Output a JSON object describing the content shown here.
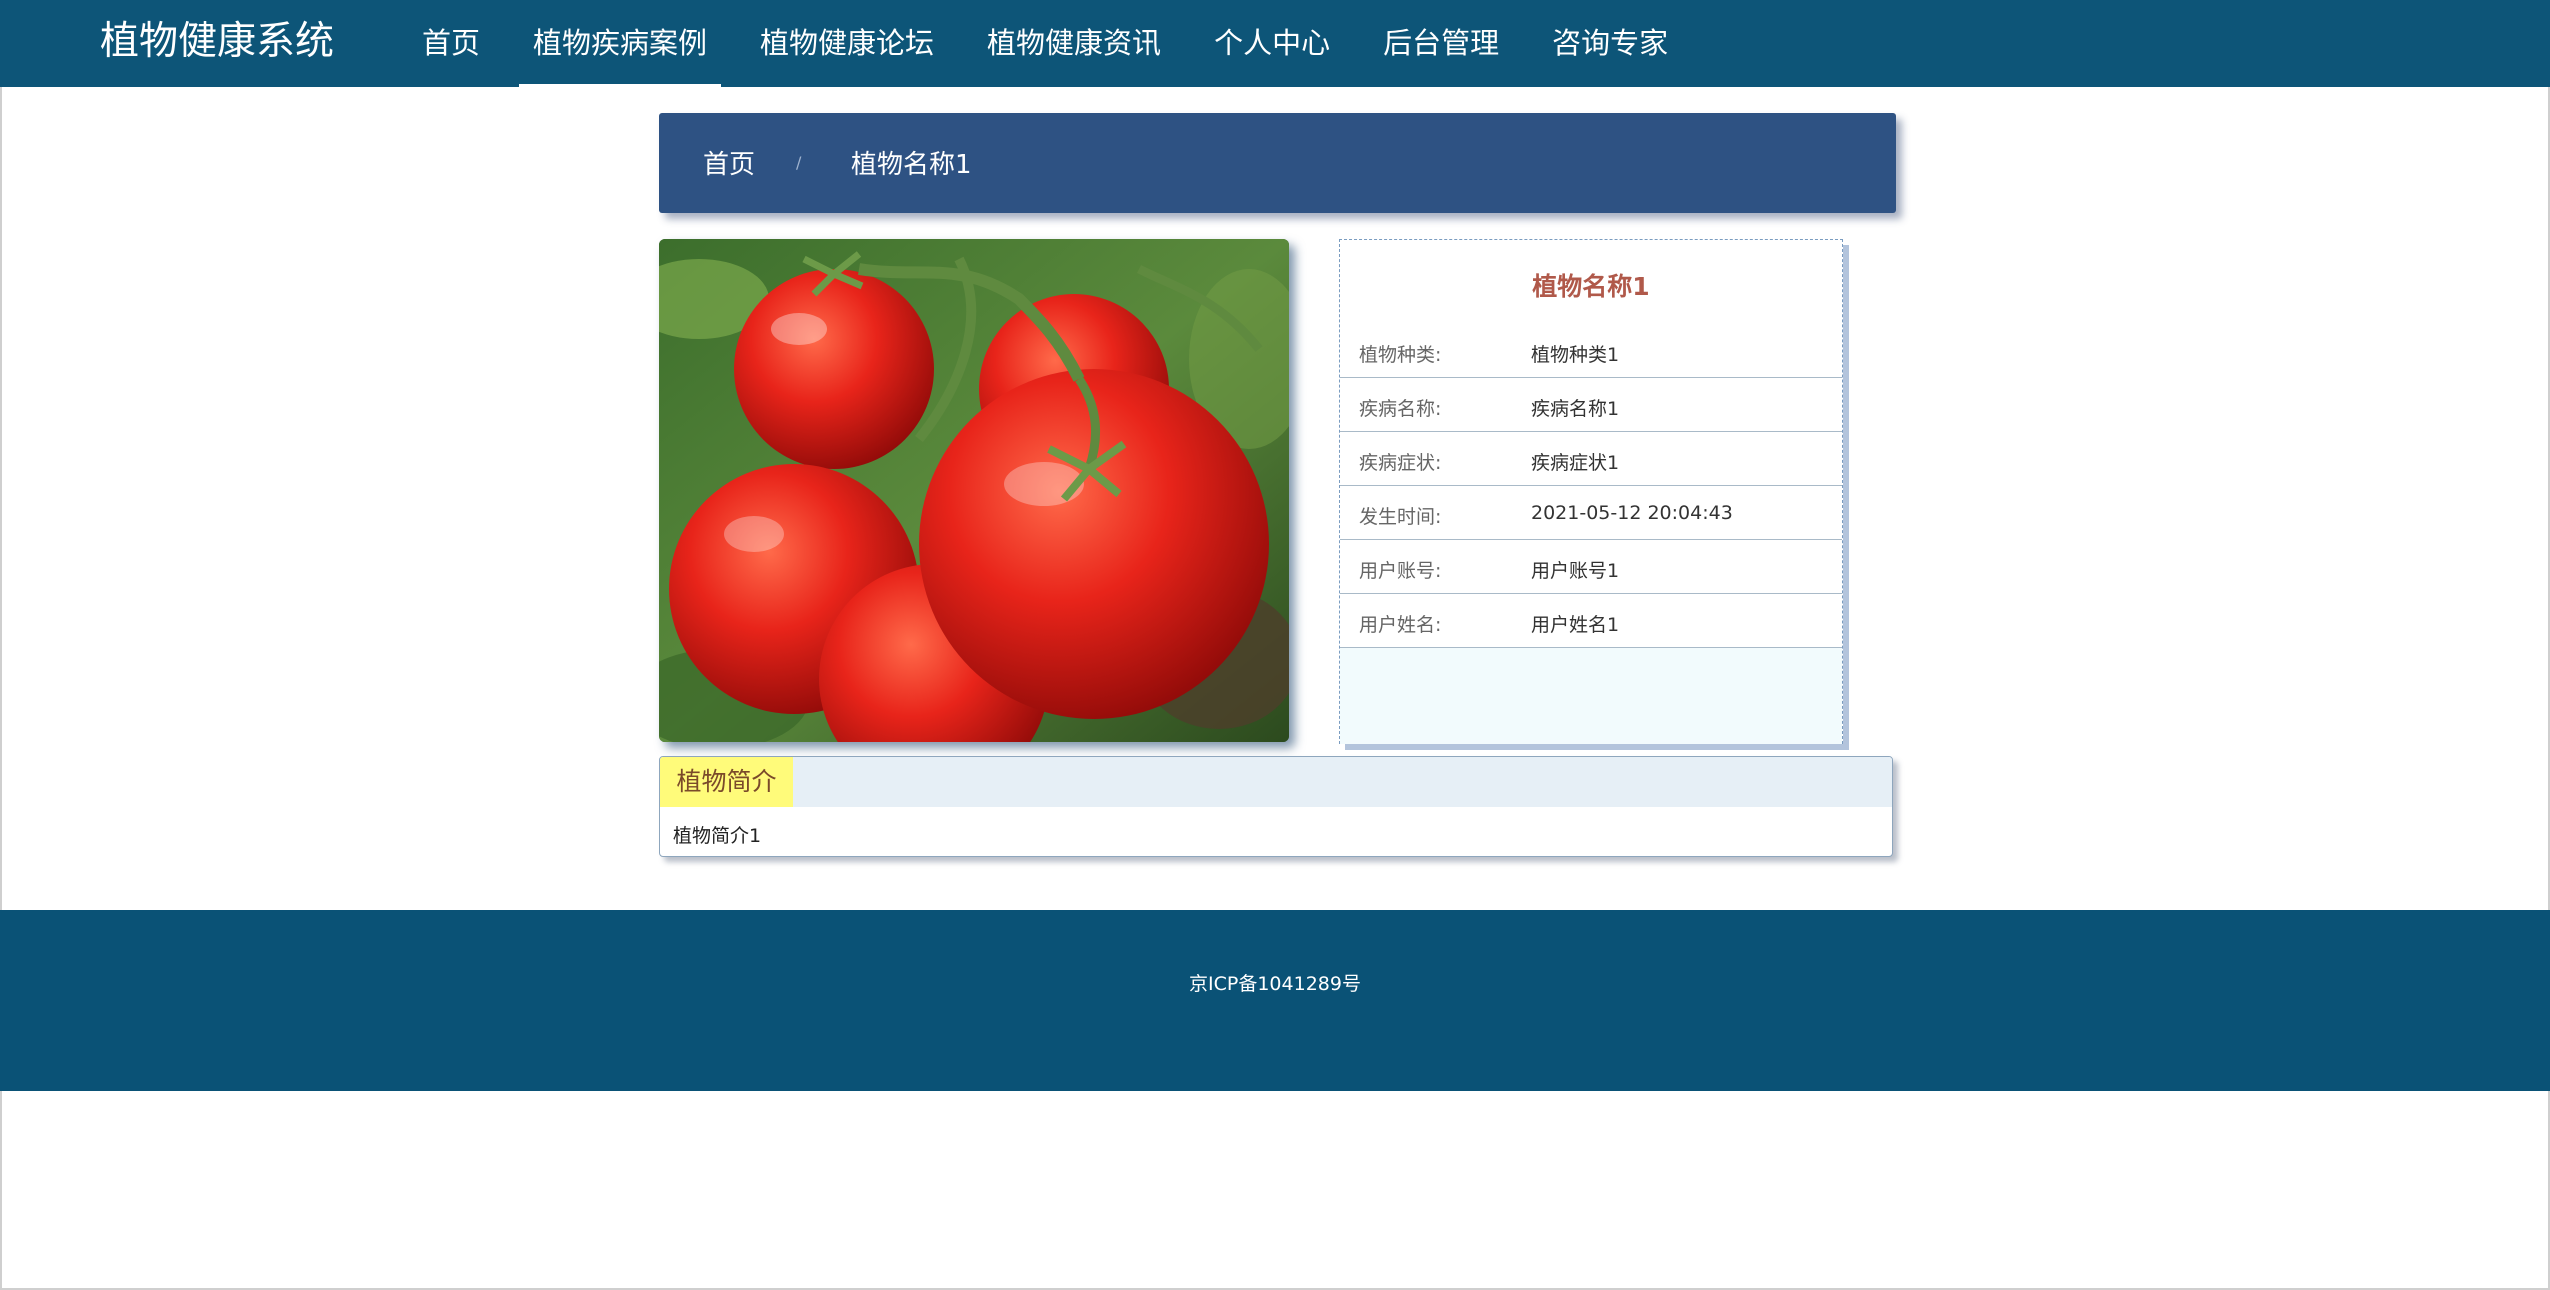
{
  "header": {
    "brand": "植物健康系统",
    "nav": [
      {
        "label": "首页"
      },
      {
        "label": "植物疾病案例"
      },
      {
        "label": "植物健康论坛"
      },
      {
        "label": "植物健康资讯"
      },
      {
        "label": "个人中心"
      },
      {
        "label": "后台管理"
      },
      {
        "label": "咨询专家"
      }
    ],
    "active_index": 1
  },
  "breadcrumb": {
    "home": "首页",
    "separator": "/",
    "current": "植物名称1"
  },
  "photo": {
    "subject": "red tomatoes on the vine"
  },
  "detail": {
    "title": "植物名称1",
    "rows": [
      {
        "label": "植物种类:",
        "value": "植物种类1"
      },
      {
        "label": "疾病名称:",
        "value": "疾病名称1"
      },
      {
        "label": "疾病症状:",
        "value": "疾病症状1"
      },
      {
        "label": "发生时间:",
        "value": "2021-05-12 20:04:43"
      },
      {
        "label": "用户账号:",
        "value": "用户账号1"
      },
      {
        "label": "用户姓名:",
        "value": "用户姓名1"
      }
    ]
  },
  "intro": {
    "tab_label": "植物简介",
    "content": "植物简介1"
  },
  "footer": {
    "icp": "京ICP备1041289号"
  },
  "colors": {
    "header_bg": "#0d5578",
    "breadcrumb_bg": "#2e5283",
    "title_accent": "#b0594a",
    "intro_tab_bg": "#fffb7a",
    "footer_bg": "#0a5276"
  }
}
